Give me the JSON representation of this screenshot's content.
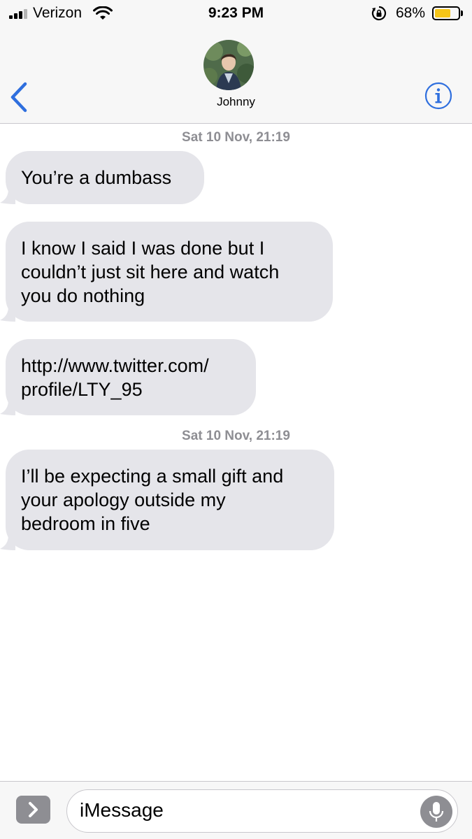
{
  "status_bar": {
    "carrier": "Verizon",
    "time": "9:23 PM",
    "battery_percent": "68%",
    "battery_level": 0.68,
    "signal_icon": "signal-bars-icon",
    "wifi_icon": "wifi-icon",
    "rotation_lock_icon": "rotation-lock-icon"
  },
  "header": {
    "contact_name": "Johnny",
    "back_icon": "chevron-left-icon",
    "info_icon": "info-icon",
    "accent_color": "#2f6fde"
  },
  "conversation": {
    "timestamp_1": "Sat 10 Nov, 21:19",
    "timestamp_2": "Sat 10 Nov, 21:19",
    "messages": [
      {
        "text": "You’re a dumbass"
      },
      {
        "text": "I know I said I was done but I\ncouldn’t just sit here and watch\nyou do nothing"
      },
      {
        "text": "http://www.twitter.com/\nprofile/LTY_95"
      },
      {
        "text": "I’ll be expecting a small gift and\nyour apology outside my\nbedroom in five"
      }
    ]
  },
  "input_bar": {
    "placeholder": "iMessage",
    "apps_icon": "chevron-right-icon",
    "mic_icon": "microphone-icon"
  },
  "colors": {
    "bubble_received": "#e5e5ea",
    "battery": "#f5c518",
    "timestamp": "#8e8e93"
  }
}
